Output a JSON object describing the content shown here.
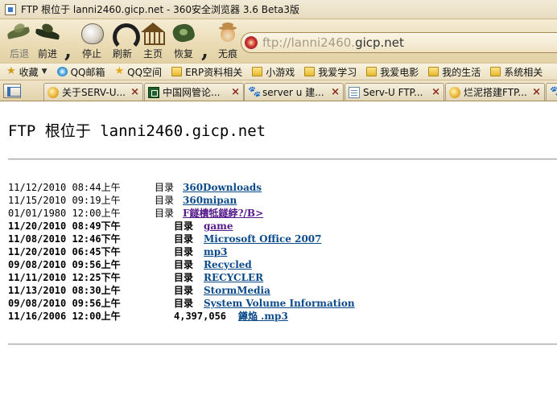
{
  "window": {
    "title": "FTP 根位于 lanni2460.gicp.net - 360安全浏览器 3.6 Beta3版"
  },
  "toolbar": {
    "back": "后退",
    "forward": "前进",
    "stop": "停止",
    "refresh": "刷新",
    "home": "主页",
    "restore": "恢复",
    "incognito": "无痕"
  },
  "address": {
    "url_prefix": "ftp://lanni2460.",
    "url_domain": "gicp.net"
  },
  "favorites": {
    "menu_label": "收藏",
    "items": [
      "QQ邮箱",
      "QQ空间",
      "ERP资料相关",
      "小游戏",
      "我爱学习",
      "我爱电影",
      "我的生活",
      "系统相关"
    ]
  },
  "tabs": [
    {
      "label": "关于SERV-U..."
    },
    {
      "label": "中国网管论..."
    },
    {
      "label": "server u 建..."
    },
    {
      "label": "Serv-U FTP..."
    },
    {
      "label": "烂泥搭建FTP..."
    }
  ],
  "tab_close_glyph": "×",
  "page": {
    "heading": "FTP 根位于 lanni2460.gicp.net",
    "entries": [
      {
        "date": "11/12/2010 08:44上午",
        "kind": "目录",
        "name": "360Downloads",
        "bold": false,
        "visited": false
      },
      {
        "date": "11/15/2010 09:19上午",
        "kind": "目录",
        "name": "360mipan",
        "bold": false,
        "visited": false
      },
      {
        "date": "01/01/1980 12:00上午",
        "kind": "目录",
        "name": "F鐩樻牴鐩綍?/B>",
        "bold": false,
        "visited": true
      },
      {
        "date": "11/20/2010 08:49下午",
        "kind": "目录",
        "name": "game",
        "bold": true,
        "visited": true
      },
      {
        "date": "11/08/2010 12:46下午",
        "kind": "目录",
        "name": "Microsoft Office 2007",
        "bold": true,
        "visited": false
      },
      {
        "date": "11/20/2010 06:45下午",
        "kind": "目录",
        "name": "mp3",
        "bold": true,
        "visited": false
      },
      {
        "date": "09/08/2010 09:56上午",
        "kind": "目录",
        "name": "Recycled",
        "bold": true,
        "visited": false
      },
      {
        "date": "11/11/2010 12:25下午",
        "kind": "目录",
        "name": "RECYCLER",
        "bold": true,
        "visited": false
      },
      {
        "date": "11/13/2010 08:30上午",
        "kind": "目录",
        "name": "StormMedia",
        "bold": true,
        "visited": false
      },
      {
        "date": "09/08/2010 09:56上午",
        "kind": "目录",
        "name": "System Volume Information",
        "bold": true,
        "visited": false
      },
      {
        "date": "11/16/2006 12:00上午",
        "kind": "4,397,056",
        "name": "鐏焔  .mp3",
        "bold": true,
        "visited": false
      }
    ]
  }
}
